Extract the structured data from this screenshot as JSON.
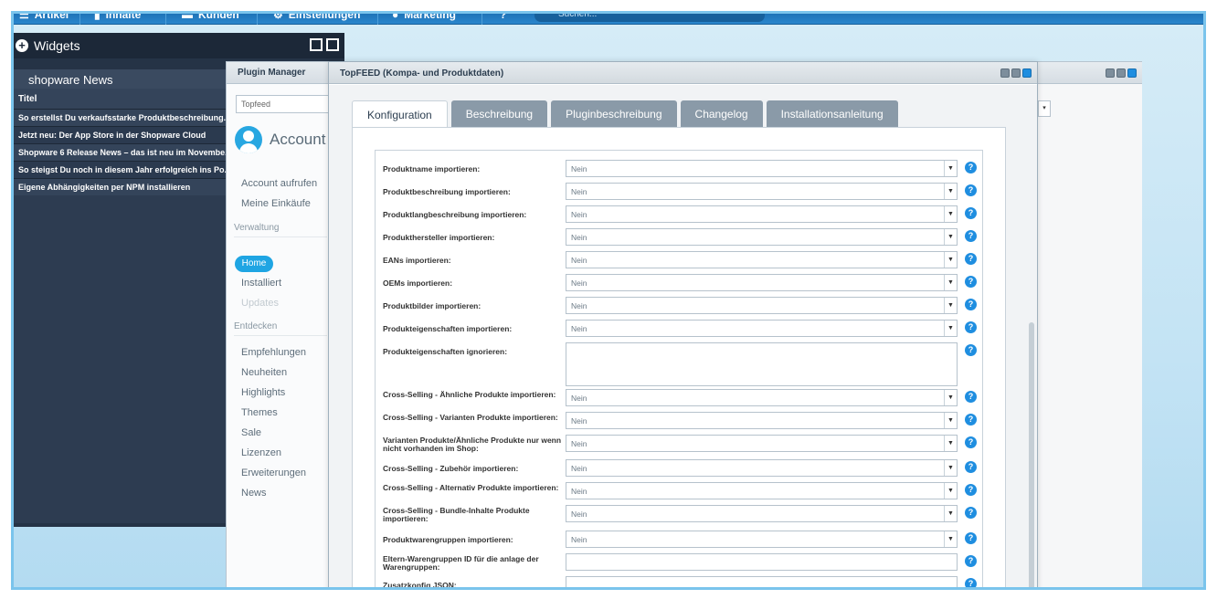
{
  "topbar": {
    "items": [
      "Artikel",
      "Inhalte",
      "Kunden",
      "Einstellungen",
      "Marketing"
    ],
    "search_placeholder": "Suchen..."
  },
  "widgets": {
    "title": "Widgets",
    "news_title": "shopware News",
    "column_header": "Titel",
    "items": [
      "So erstellst Du verkaufsstarke Produktbeschreibung...",
      "Jetzt neu: Der App Store in der Shopware Cloud",
      "Shopware 6 Release News – das ist neu im Novembe...",
      "So steigst Du noch in diesem Jahr erfolgreich ins Po...",
      "Eigene Abhängigkeiten per NPM installieren"
    ]
  },
  "plugin_manager": {
    "title": "Plugin Manager",
    "search_value": "Topfeed",
    "account_label": "Account",
    "links_account": [
      "Account aufrufen",
      "Meine Einkäufe"
    ],
    "section_verwaltung": "Verwaltung",
    "home": "Home",
    "installed": "Installiert",
    "updates": "Updates",
    "section_entdecken": "Entdecken",
    "links_discover": [
      "Empfehlungen",
      "Neuheiten",
      "Highlights",
      "Themes",
      "Sale",
      "Lizenzen",
      "Erweiterungen",
      "News"
    ]
  },
  "topfeed": {
    "title": "TopFEED (Kompa- und Produktdaten)",
    "tabs": [
      "Konfiguration",
      "Beschreibung",
      "Pluginbeschreibung",
      "Changelog",
      "Installationsanleitung"
    ],
    "default_value": "Nein",
    "fields": [
      {
        "label": "Produktname importieren:",
        "type": "select",
        "value": "Nein"
      },
      {
        "label": "Produktbeschreibung importieren:",
        "type": "select",
        "value": "Nein"
      },
      {
        "label": "Produktlangbeschreibung importieren:",
        "type": "select",
        "value": "Nein"
      },
      {
        "label": "Produkthersteller importieren:",
        "type": "select",
        "value": "Nein"
      },
      {
        "label": "EANs importieren:",
        "type": "select",
        "value": "Nein"
      },
      {
        "label": "OEMs importieren:",
        "type": "select",
        "value": "Nein"
      },
      {
        "label": "Produktbilder importieren:",
        "type": "select",
        "value": "Nein"
      },
      {
        "label": "Produkteigenschaften importieren:",
        "type": "select",
        "value": "Nein"
      },
      {
        "label": "Produkteigenschaften ignorieren:",
        "type": "textarea",
        "value": ""
      },
      {
        "label": "Cross-Selling - Ähnliche Produkte importieren:",
        "type": "select",
        "value": "Nein"
      },
      {
        "label": "Cross-Selling - Varianten Produkte importieren:",
        "type": "select",
        "value": "Nein"
      },
      {
        "label": "Varianten Produkte/Ähnliche Produkte nur wenn nicht vorhanden im Shop:",
        "type": "select",
        "value": "Nein"
      },
      {
        "label": "Cross-Selling - Zubehör importieren:",
        "type": "select",
        "value": "Nein"
      },
      {
        "label": "Cross-Selling - Alternativ Produkte importieren:",
        "type": "select",
        "value": "Nein"
      },
      {
        "label": "Cross-Selling - Bundle-Inhalte Produkte importieren:",
        "type": "select",
        "value": "Nein"
      },
      {
        "label": "Produktwarengruppen importieren:",
        "type": "select",
        "value": "Nein"
      },
      {
        "label": "Eltern-Warengruppen ID für die anlage der Warengruppen:",
        "type": "input",
        "value": ""
      },
      {
        "label": "Zusatzkonfig JSON:",
        "type": "input",
        "value": ""
      }
    ]
  }
}
